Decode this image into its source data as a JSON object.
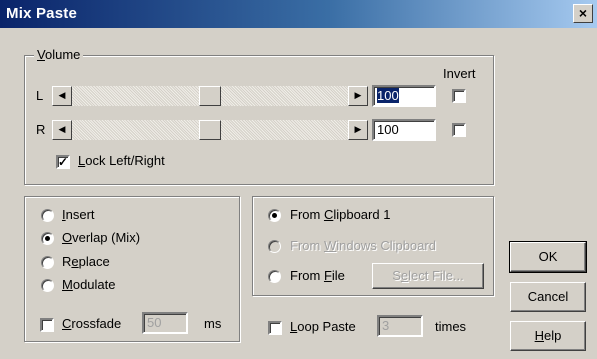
{
  "window": {
    "title": "Mix Paste",
    "close_glyph": "×"
  },
  "volume": {
    "group_label": "Volume",
    "group_mnemonic": "V",
    "group_rest": "olume",
    "invert_label": "Invert",
    "left": {
      "label": "L",
      "value": "100",
      "slider_level": 0.5,
      "invert_checked": false
    },
    "right": {
      "label": "R",
      "value": "100",
      "slider_level": 0.5,
      "invert_checked": false
    },
    "lock": {
      "mnemonic": "L",
      "rest": "ock Left/Right",
      "checked": true
    }
  },
  "paste_mode": {
    "options": [
      {
        "mnemonic": "I",
        "rest": "nsert",
        "checked": false
      },
      {
        "mnemonic": "O",
        "rest": "verlap (Mix)",
        "checked": true
      },
      {
        "pre": "R",
        "mnemonic": "e",
        "rest": "place",
        "checked": false
      },
      {
        "mnemonic": "M",
        "rest": "odulate",
        "checked": false
      }
    ],
    "crossfade": {
      "mnemonic": "C",
      "rest": "rossfade",
      "value": "50",
      "unit": "ms",
      "checked": false
    }
  },
  "source": {
    "clipboard1": {
      "pre": "From ",
      "mnemonic": "C",
      "rest": "lipboard 1",
      "checked": true
    },
    "windows_clipboard": {
      "pre": "From ",
      "mnemonic": "W",
      "rest": "indows Clipboard",
      "checked": false,
      "enabled": false
    },
    "from_file": {
      "pre": "From ",
      "mnemonic": "F",
      "rest": "ile",
      "checked": false
    },
    "select_file": {
      "pre": "S",
      "mnemonic": "e",
      "rest": "lect File..."
    },
    "loop": {
      "mnemonic": "L",
      "rest": "oop Paste",
      "value": "3",
      "unit": "times",
      "checked": false
    }
  },
  "buttons": {
    "ok": "OK",
    "cancel": "Cancel",
    "help_mnemonic": "H",
    "help_rest": "elp"
  }
}
